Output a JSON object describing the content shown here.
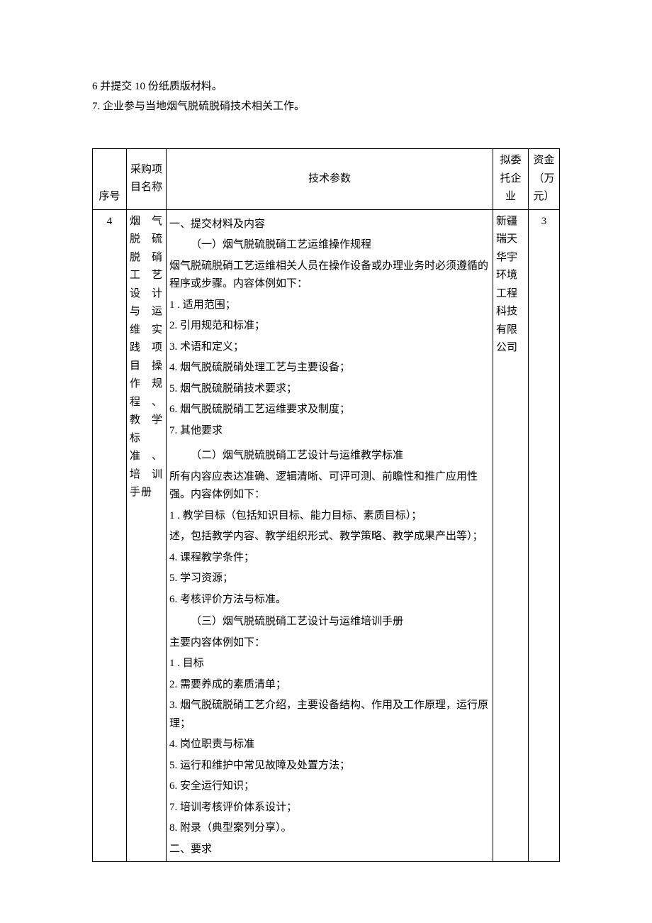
{
  "preamble": {
    "line1": "6 并提交 10 份纸质版材料。",
    "line2": "7. 企业参与当地烟气脱硫脱硝技术相关工作。"
  },
  "headers": {
    "seq": "序号",
    "name": "采购项目名称",
    "spec": "技术参数",
    "entrust": "拟委托企业",
    "fund": "资金（万元）"
  },
  "row": {
    "seq": "4",
    "name": "烟气脱硫脱硝工艺设计与运维实践项目操作规程、教学标准、培训手册",
    "entrust": "新疆瑞天华宇环境工程科技有限公司",
    "fund": "3",
    "spec": {
      "s1_title": "一、提交材料及内容",
      "s1a_heading": "（一）烟气脱硫脱硝工艺运维操作规程",
      "s1a_intro": "烟气脱硫脱硝工艺运维相关人员在操作设备或办理业务时必须遵循的程序或步骤。内容体例如下：",
      "s1a_items": [
        "1        . 适用范围；",
        "2. 引用规范和标准；",
        "3. 术语和定义；",
        "4. 烟气脱硫脱硝处理工艺与主要设备；",
        "5. 烟气脱硫脱硝技术要求；",
        "6. 烟气脱硫脱硝工艺运维要求及制度；",
        "7. 其他要求"
      ],
      "s1b_heading": "（二）烟气脱硫脱硝工艺设计与运维教学标准",
      "s1b_intro": "所有内容应表达准确、逻辑清晰、可评可测、前瞻性和推广应用性强。内容体例如下：",
      "s1b_items": [
        "1        . 教学目标（包括知识目标、能力目标、素质目标）；",
        "述，包括教学内容、教学组织形式、教学策略、教学成果产出等）；",
        "4. 课程教学条件；",
        "5. 学习资源；",
        "6. 考核评价方法与标准。"
      ],
      "s1c_heading": "（三）烟气脱硫脱硝工艺设计与运维培训手册",
      "s1c_intro": "主要内容体例如下：",
      "s1c_items": [
        "1        . 目标",
        "2. 需要养成的素质清单；",
        "3. 烟气脱硫脱硝工艺介绍，主要设备结构、作用及工作原理，运行原理；",
        "4. 岗位职责与标准",
        "5. 运行和维护中常见故障及处置方法；",
        "6. 安全运行知识；",
        "7. 培训考核评价体系设计；",
        "8. 附录（典型案列分享）。"
      ],
      "s2_title": "二、要求"
    }
  }
}
